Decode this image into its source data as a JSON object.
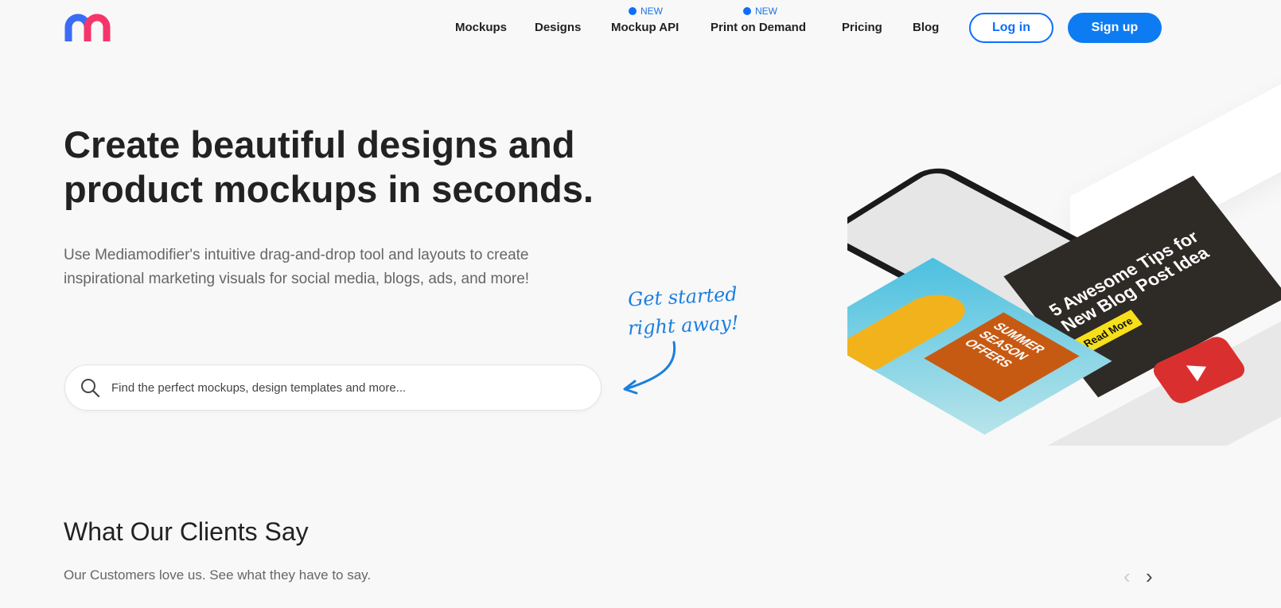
{
  "brand": {
    "logo_colors": [
      "#3b6cf6",
      "#f5366b"
    ]
  },
  "nav": {
    "items": [
      {
        "label": "Mockups"
      },
      {
        "label": "Designs"
      },
      {
        "label": "Mockup API",
        "badge": "NEW"
      },
      {
        "label": "Print on Demand",
        "badge": "NEW"
      },
      {
        "label": "Pricing"
      },
      {
        "label": "Blog"
      }
    ],
    "login": "Log in",
    "signup": "Sign up"
  },
  "hero": {
    "title": "Create beautiful designs and product mockups in seconds.",
    "subtitle": "Use Mediamodifier's intuitive drag-and-drop tool and layouts to create inspirational marketing visuals for social media, blogs, ads, and more!",
    "search_placeholder": "Find the perfect mockups, design templates and more...",
    "callout_line1": "Get started",
    "callout_line2": "right away!"
  },
  "illustration": {
    "summer_title": "SUMMER SEASON OFFERS",
    "blog_title": "5 Awesome Tips for New Blog Post Idea",
    "read_more": "Read More"
  },
  "clients": {
    "title": "What Our Clients Say",
    "subtitle": "Our Customers love us. See what they have to say."
  },
  "colors": {
    "accent": "#0d7cf2",
    "background": "#f8f8f8"
  }
}
